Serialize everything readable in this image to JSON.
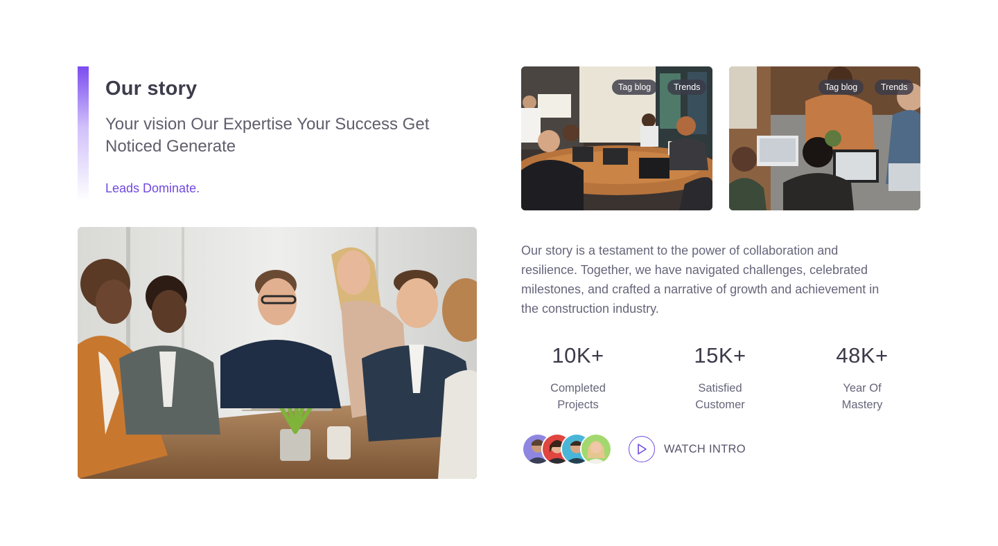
{
  "story": {
    "title": "Our story",
    "subtitle": "Your vision Our Expertise Your Success Get Noticed Generate",
    "link": "Leads Dominate.",
    "body": "Our story is a testament to the power of collaboration and resilience. Together, we have navigated challenges, celebrated milestones, and crafted a narrative of growth and achievement in the construction industry."
  },
  "blog_cards": [
    {
      "tags": [
        "Tag blog",
        "Trends"
      ],
      "image": "conference-meeting-photo"
    },
    {
      "tags": [
        "Tag blog",
        "Trends"
      ],
      "image": "team-laptops-photo"
    }
  ],
  "stats": [
    {
      "value": "10K+",
      "label": "Completed Projects"
    },
    {
      "value": "15K+",
      "label": "Satisfied Customer"
    },
    {
      "value": "48K+",
      "label": "Year Of Mastery"
    }
  ],
  "watch_intro": {
    "label": "WATCH INTRO",
    "icon": "play-icon"
  },
  "colors": {
    "accent": "#7047e0",
    "heading": "#3d3c4c",
    "body_text": "#66657a"
  }
}
